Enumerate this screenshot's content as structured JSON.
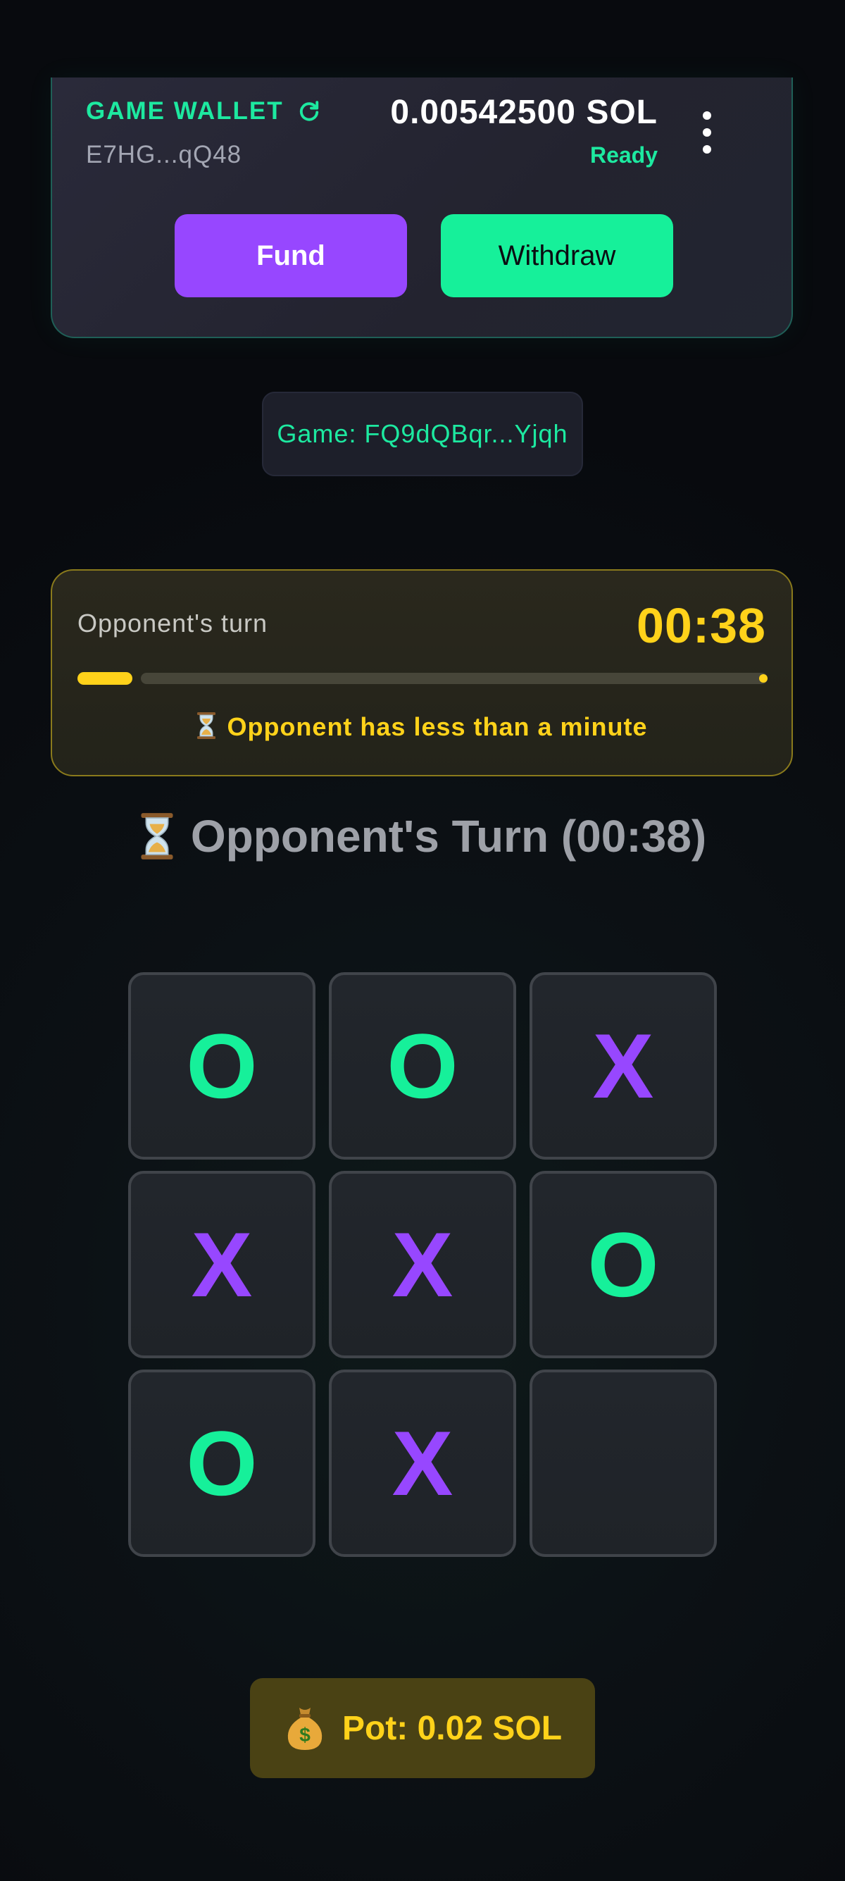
{
  "wallet": {
    "title": "GAME WALLET",
    "address": "E7HG...qQ48",
    "balance": "0.00542500 SOL",
    "status": "Ready",
    "fund_label": "Fund",
    "withdraw_label": "Withdraw",
    "refresh_icon": "refresh-icon",
    "menu_icon": "more-vertical-icon"
  },
  "game": {
    "id_text": "Game: FQ9dQBqr...Yjqh"
  },
  "timer": {
    "label": "Opponent's turn",
    "value": "00:38",
    "progress": 0.08,
    "warning": "Opponent has less than a minute",
    "warning_icon": "hourglass-icon"
  },
  "turn_heading": {
    "text": "Opponent's Turn (00:38)",
    "icon": "hourglass-icon"
  },
  "board": {
    "cells": [
      "O",
      "O",
      "X",
      "X",
      "X",
      "O",
      "O",
      "X",
      ""
    ]
  },
  "pot": {
    "text": "Pot: 0.02 SOL",
    "icon": "money-bag-icon"
  },
  "colors": {
    "accent_green": "#16f09a",
    "accent_purple": "#9747ff",
    "accent_yellow": "#ffd21a"
  }
}
